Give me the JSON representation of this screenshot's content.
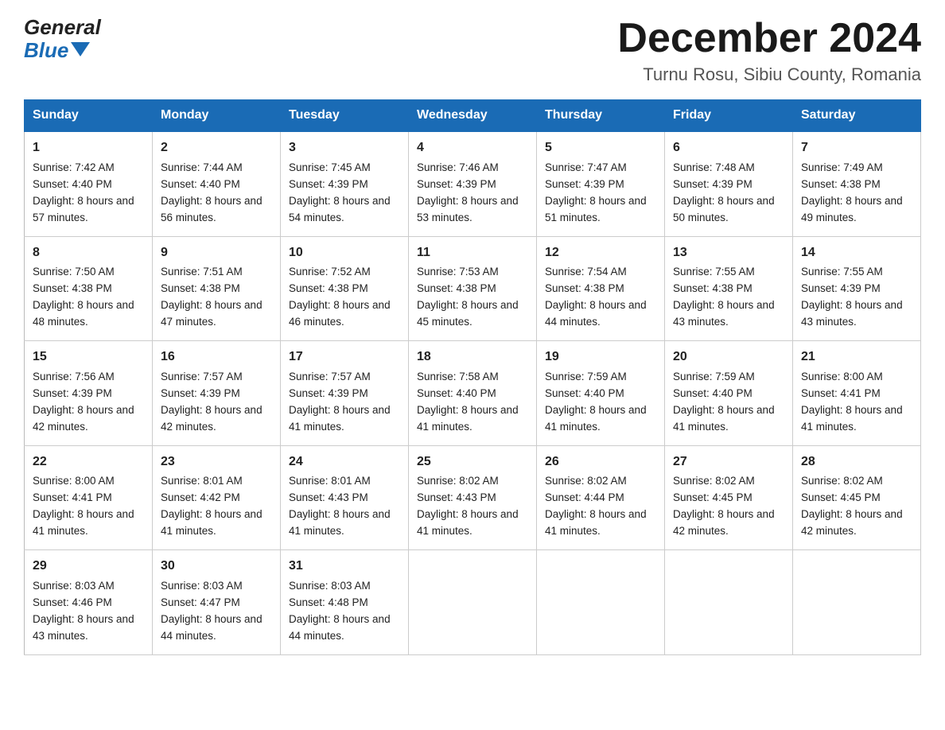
{
  "header": {
    "logo_general": "General",
    "logo_blue": "Blue",
    "month_title": "December 2024",
    "location": "Turnu Rosu, Sibiu County, Romania"
  },
  "days_of_week": [
    "Sunday",
    "Monday",
    "Tuesday",
    "Wednesday",
    "Thursday",
    "Friday",
    "Saturday"
  ],
  "weeks": [
    [
      {
        "day": "1",
        "sunrise": "7:42 AM",
        "sunset": "4:40 PM",
        "daylight": "8 hours and 57 minutes."
      },
      {
        "day": "2",
        "sunrise": "7:44 AM",
        "sunset": "4:40 PM",
        "daylight": "8 hours and 56 minutes."
      },
      {
        "day": "3",
        "sunrise": "7:45 AM",
        "sunset": "4:39 PM",
        "daylight": "8 hours and 54 minutes."
      },
      {
        "day": "4",
        "sunrise": "7:46 AM",
        "sunset": "4:39 PM",
        "daylight": "8 hours and 53 minutes."
      },
      {
        "day": "5",
        "sunrise": "7:47 AM",
        "sunset": "4:39 PM",
        "daylight": "8 hours and 51 minutes."
      },
      {
        "day": "6",
        "sunrise": "7:48 AM",
        "sunset": "4:39 PM",
        "daylight": "8 hours and 50 minutes."
      },
      {
        "day": "7",
        "sunrise": "7:49 AM",
        "sunset": "4:38 PM",
        "daylight": "8 hours and 49 minutes."
      }
    ],
    [
      {
        "day": "8",
        "sunrise": "7:50 AM",
        "sunset": "4:38 PM",
        "daylight": "8 hours and 48 minutes."
      },
      {
        "day": "9",
        "sunrise": "7:51 AM",
        "sunset": "4:38 PM",
        "daylight": "8 hours and 47 minutes."
      },
      {
        "day": "10",
        "sunrise": "7:52 AM",
        "sunset": "4:38 PM",
        "daylight": "8 hours and 46 minutes."
      },
      {
        "day": "11",
        "sunrise": "7:53 AM",
        "sunset": "4:38 PM",
        "daylight": "8 hours and 45 minutes."
      },
      {
        "day": "12",
        "sunrise": "7:54 AM",
        "sunset": "4:38 PM",
        "daylight": "8 hours and 44 minutes."
      },
      {
        "day": "13",
        "sunrise": "7:55 AM",
        "sunset": "4:38 PM",
        "daylight": "8 hours and 43 minutes."
      },
      {
        "day": "14",
        "sunrise": "7:55 AM",
        "sunset": "4:39 PM",
        "daylight": "8 hours and 43 minutes."
      }
    ],
    [
      {
        "day": "15",
        "sunrise": "7:56 AM",
        "sunset": "4:39 PM",
        "daylight": "8 hours and 42 minutes."
      },
      {
        "day": "16",
        "sunrise": "7:57 AM",
        "sunset": "4:39 PM",
        "daylight": "8 hours and 42 minutes."
      },
      {
        "day": "17",
        "sunrise": "7:57 AM",
        "sunset": "4:39 PM",
        "daylight": "8 hours and 41 minutes."
      },
      {
        "day": "18",
        "sunrise": "7:58 AM",
        "sunset": "4:40 PM",
        "daylight": "8 hours and 41 minutes."
      },
      {
        "day": "19",
        "sunrise": "7:59 AM",
        "sunset": "4:40 PM",
        "daylight": "8 hours and 41 minutes."
      },
      {
        "day": "20",
        "sunrise": "7:59 AM",
        "sunset": "4:40 PM",
        "daylight": "8 hours and 41 minutes."
      },
      {
        "day": "21",
        "sunrise": "8:00 AM",
        "sunset": "4:41 PM",
        "daylight": "8 hours and 41 minutes."
      }
    ],
    [
      {
        "day": "22",
        "sunrise": "8:00 AM",
        "sunset": "4:41 PM",
        "daylight": "8 hours and 41 minutes."
      },
      {
        "day": "23",
        "sunrise": "8:01 AM",
        "sunset": "4:42 PM",
        "daylight": "8 hours and 41 minutes."
      },
      {
        "day": "24",
        "sunrise": "8:01 AM",
        "sunset": "4:43 PM",
        "daylight": "8 hours and 41 minutes."
      },
      {
        "day": "25",
        "sunrise": "8:02 AM",
        "sunset": "4:43 PM",
        "daylight": "8 hours and 41 minutes."
      },
      {
        "day": "26",
        "sunrise": "8:02 AM",
        "sunset": "4:44 PM",
        "daylight": "8 hours and 41 minutes."
      },
      {
        "day": "27",
        "sunrise": "8:02 AM",
        "sunset": "4:45 PM",
        "daylight": "8 hours and 42 minutes."
      },
      {
        "day": "28",
        "sunrise": "8:02 AM",
        "sunset": "4:45 PM",
        "daylight": "8 hours and 42 minutes."
      }
    ],
    [
      {
        "day": "29",
        "sunrise": "8:03 AM",
        "sunset": "4:46 PM",
        "daylight": "8 hours and 43 minutes."
      },
      {
        "day": "30",
        "sunrise": "8:03 AM",
        "sunset": "4:47 PM",
        "daylight": "8 hours and 44 minutes."
      },
      {
        "day": "31",
        "sunrise": "8:03 AM",
        "sunset": "4:48 PM",
        "daylight": "8 hours and 44 minutes."
      },
      null,
      null,
      null,
      null
    ]
  ],
  "labels": {
    "sunrise": "Sunrise:",
    "sunset": "Sunset:",
    "daylight": "Daylight:"
  }
}
